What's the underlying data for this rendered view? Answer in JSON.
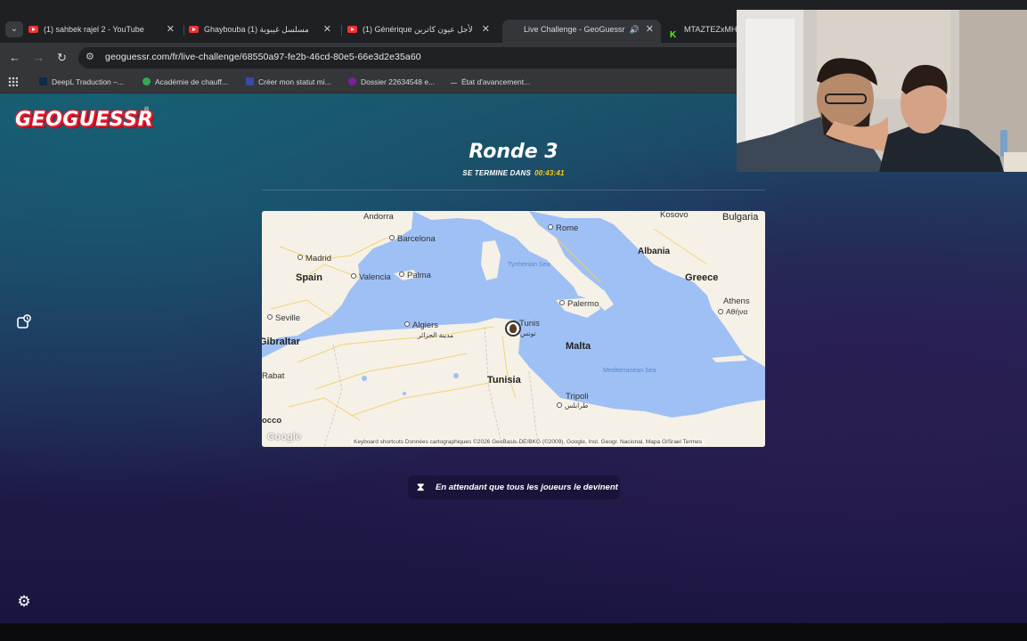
{
  "tabs": [
    {
      "title": "(1) sahbek rajel 2 - YouTube",
      "favicon": "youtube-icon"
    },
    {
      "title": "Ghaybouba مسلسل غيبوبة (1)",
      "favicon": "youtube-icon"
    },
    {
      "title": "(1) Générique لأجل عيون كاترين",
      "favicon": "youtube-icon"
    },
    {
      "title": "Live Challenge - GeoGuessr",
      "favicon": "geoguessr-pin-icon",
      "active": true
    },
    {
      "title": "MTAZTEZxMHI",
      "favicon": "kick-icon"
    }
  ],
  "address_bar": {
    "url": "geoguessr.com/fr/live-challenge/68550a97-fe2b-46cd-80e5-66e3d2e35a60"
  },
  "bookmarks": [
    {
      "label": "DeepL Traduction –...",
      "color": "#0f2b46"
    },
    {
      "label": "Académie de chauff...",
      "color": "#34a853"
    },
    {
      "label": "Créer mon statut mi...",
      "color": "#1a237e"
    },
    {
      "label": "Dossier 22634548 e...",
      "color": "#7b1fa2"
    },
    {
      "label": "État d'avancement...",
      "color": "#5f6368"
    }
  ],
  "game": {
    "logo": "GEOGUESSR",
    "round_title": "Ronde 3",
    "timer_label": "SE TERMINE DANS",
    "timer_value": "00:43:41",
    "status_text": "En attendant que tous les joueurs le devinent"
  },
  "map": {
    "labels": {
      "andorra": "Andorra",
      "kosovo": "Kosovo",
      "bulgaria": "Bulgaria",
      "barcelona": "Barcelona",
      "rome": "Rome",
      "madrid": "Madrid",
      "albania": "Albania",
      "tyrrhenian": "Tyrrhenian Sea",
      "spain": "Spain",
      "valencia": "Valencia",
      "palma": "Palma",
      "greece": "Greece",
      "palermo": "Palermo",
      "athens": "Athens",
      "athens_local": "Αθήνα",
      "seville": "Seville",
      "algiers": "Algiers",
      "algiers_local": "مدينة الجزائر",
      "tunis": "Tunis",
      "tunis_local": "تونس",
      "gibraltar": "Gibraltar",
      "malta": "Malta",
      "rabat": "Rabat",
      "med_sea": "Mediterranean Sea",
      "tunisia": "Tunisia",
      "tripoli": "Tripoli",
      "tripoli_local": "طرابلس",
      "morocco": "occo"
    },
    "google": "Google",
    "attribution": "Keyboard shortcuts   Données cartographiques ©2026 GeoBasis-DE/BKG (©2009), Google, Inst. Geogr. Nacional, Mapa GISrael   Termes"
  },
  "colors": {
    "accent_yellow": "#fecd19",
    "brand_red": "#e11d2e",
    "map_water": "#9ec0f5",
    "map_land": "#f5f1e6"
  }
}
